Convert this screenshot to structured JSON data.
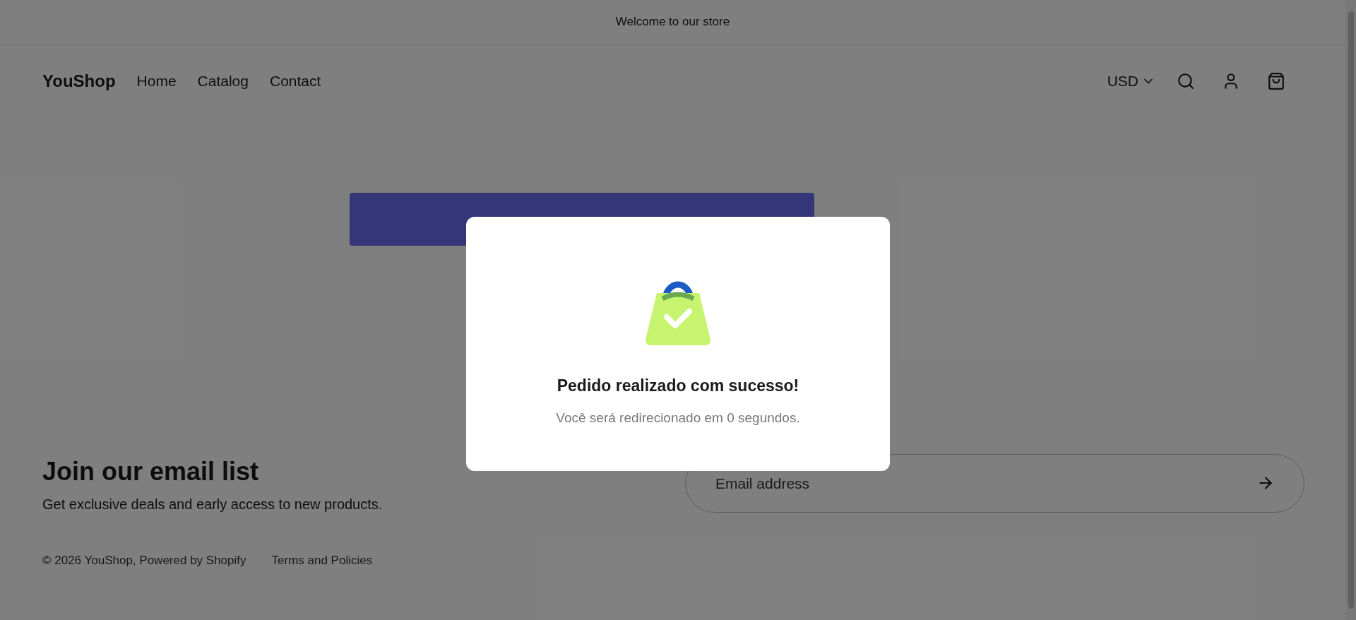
{
  "announcement": "Welcome to our store",
  "header": {
    "logo": "YouShop",
    "nav": [
      "Home",
      "Catalog",
      "Contact"
    ],
    "currency": "USD"
  },
  "newsletter": {
    "title": "Join our email list",
    "subtitle": "Get exclusive deals and early access to new products.",
    "email_field": {
      "placeholder": "Email address"
    }
  },
  "footer": {
    "copyright": "© 2026 YouShop, Powered by Shopify",
    "links": [
      "Terms and Policies"
    ]
  },
  "modal": {
    "title": "Pedido realizado com sucesso!",
    "message": "Você será redirecionado em 0 segundos."
  }
}
